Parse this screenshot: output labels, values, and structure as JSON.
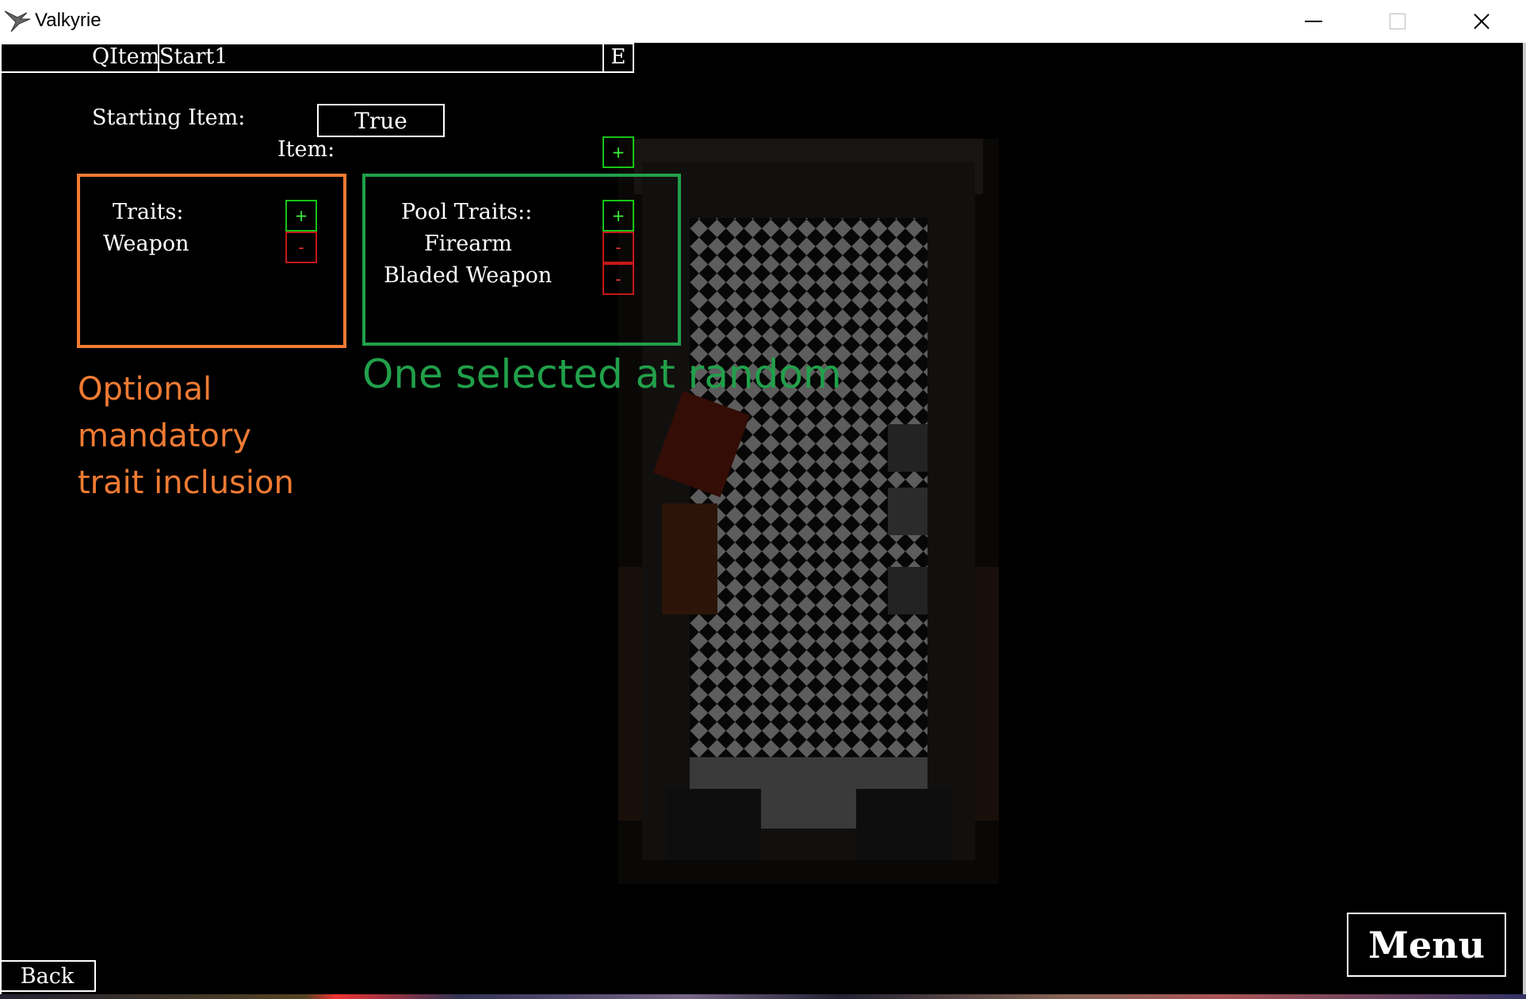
{
  "window": {
    "title": "Valkyrie",
    "controls": [
      "minimize",
      "maximize",
      "close"
    ]
  },
  "header": {
    "type_label": "QItem",
    "name_value": "Start1",
    "edit_label": "E"
  },
  "form": {
    "starting_item_label": "Starting Item:",
    "starting_item_value": "True",
    "item_label": "Item:",
    "add_symbol": "+",
    "remove_symbol": "-"
  },
  "traits": {
    "label": "Traits:",
    "items": [
      "Weapon"
    ]
  },
  "pool_traits": {
    "label": "Pool Traits::",
    "items": [
      "Firearm",
      "Bladed Weapon"
    ]
  },
  "annotations": {
    "orange_lines": [
      "Optional",
      "mandatory",
      "trait inclusion"
    ],
    "green": "One selected at random",
    "orange_color": "#f07b33",
    "green_color": "#21a04a"
  },
  "footer": {
    "back_label": "Back",
    "menu_label": "Menu"
  }
}
